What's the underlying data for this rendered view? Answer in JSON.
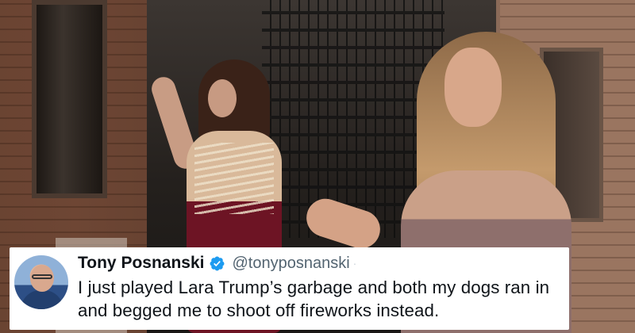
{
  "tweet": {
    "display_name": "Tony Posnanski",
    "handle": "@tonyposnanski",
    "more_indicator": "·",
    "text": "I just played Lara Trump’s garbage and both my dogs ran in and begged me to shoot off fireworks instead.",
    "verified": true,
    "verified_color": "#1d9bf0"
  },
  "icons": {
    "verified": "verified-badge-icon",
    "avatar": "profile-photo"
  },
  "colors": {
    "card_background": "#ffffff",
    "text_primary": "#0f1419",
    "text_secondary": "#536471"
  }
}
